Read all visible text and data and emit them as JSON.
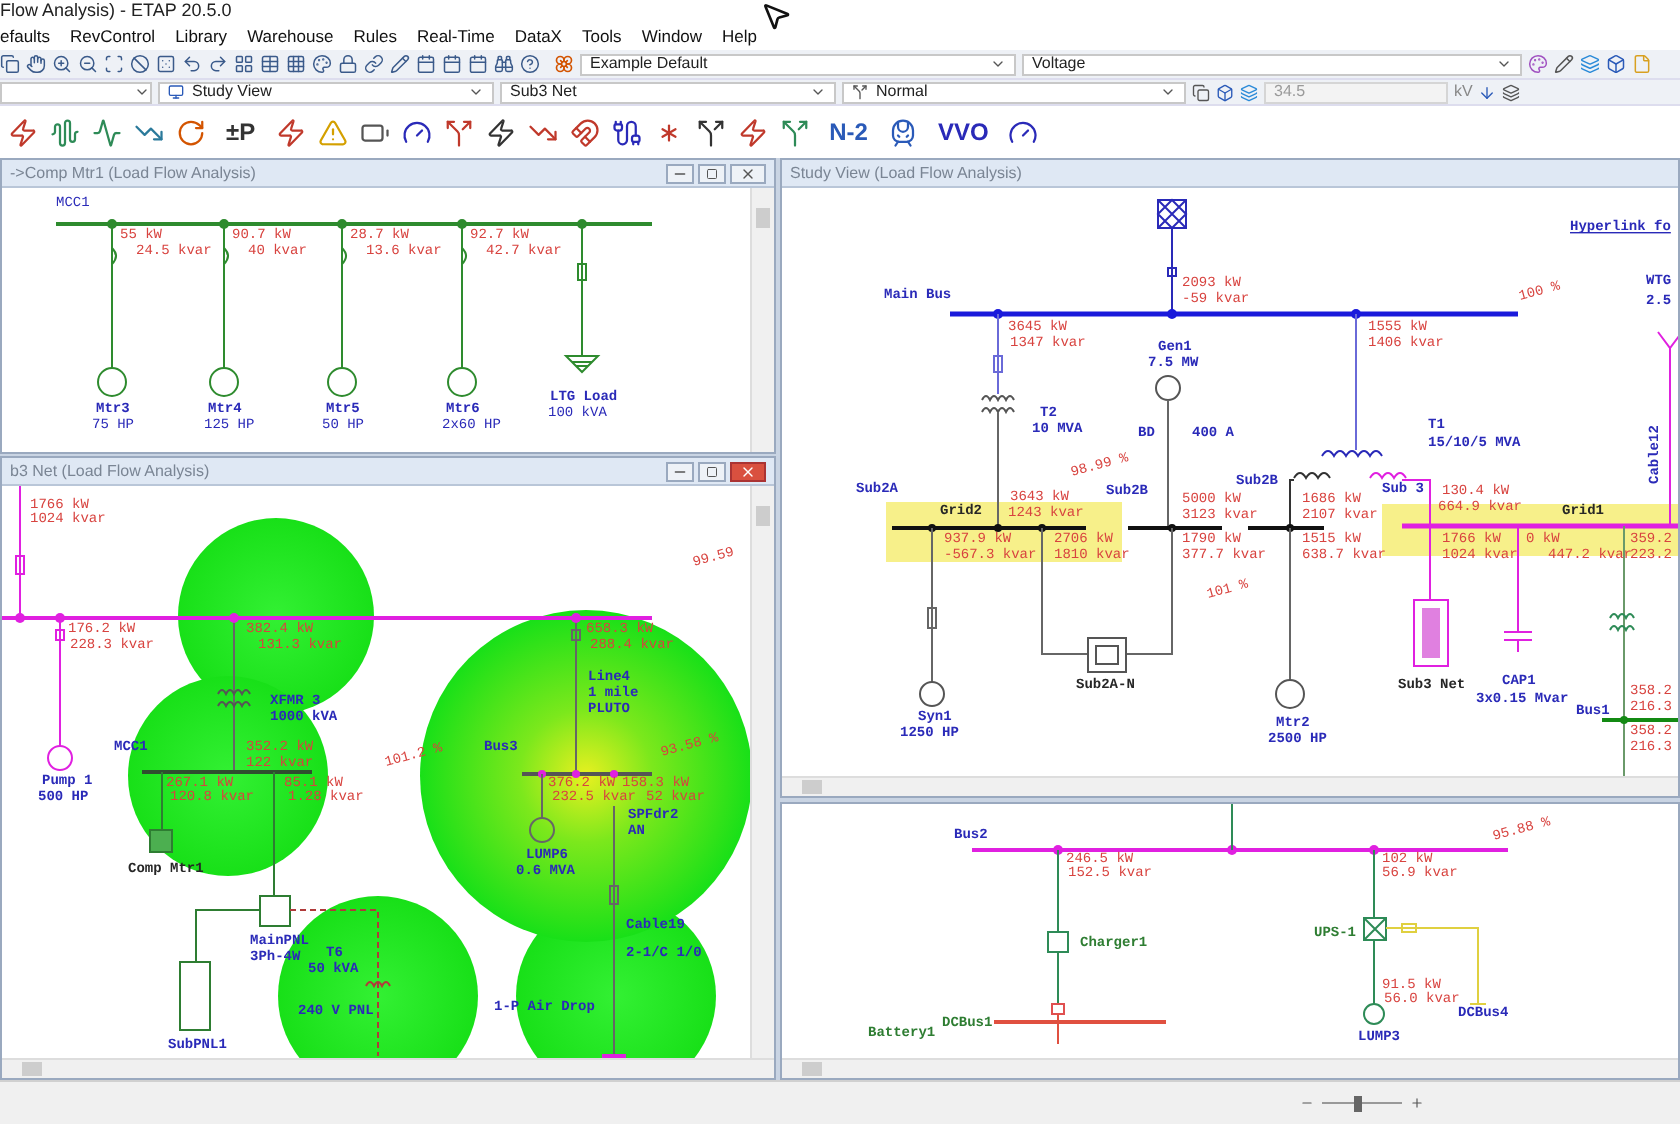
{
  "title_bar": {
    "title": "Flow Analysis) - ETAP 20.5.0"
  },
  "menu": [
    "efaults",
    "RevControl",
    "Library",
    "Warehouse",
    "Rules",
    "Real-Time",
    "DataX",
    "Tools",
    "Window",
    "Help"
  ],
  "toolbar": {
    "presentation": "Example Default",
    "display": "Voltage"
  },
  "toolbar2": {
    "view": "Study View",
    "network": "Sub3 Net",
    "config": "Normal",
    "voltage": {
      "value": "34.5",
      "disabled": true
    },
    "unit": "kV"
  },
  "analysis_toolbar": {
    "labels": [
      "±P",
      "N-2",
      "VVO"
    ]
  },
  "mcc_window": {
    "title": "->Comp Mtr1 (Load Flow Analysis)",
    "bus": "MCC1",
    "loads": [
      {
        "name": "Mtr3",
        "rating": "75 HP",
        "kw": "55 kW",
        "kvar": "24.5 kvar"
      },
      {
        "name": "Mtr4",
        "rating": "125 HP",
        "kw": "90.7 kW",
        "kvar": "40 kvar"
      },
      {
        "name": "Mtr5",
        "rating": "50 HP",
        "kw": "28.7 kW",
        "kvar": "13.6 kvar"
      },
      {
        "name": "Mtr6",
        "rating": "2x60 HP",
        "kw": "92.7 kW",
        "kvar": "42.7 kvar"
      }
    ],
    "lighting_load": {
      "name": "LTG Load",
      "rating": "100 kVA"
    }
  },
  "sub3_window": {
    "title": "b3 Net (Load Flow Analysis)",
    "labels": [
      {
        "text": "1766 kW",
        "kind": "flow"
      },
      {
        "text": "1024 kvar",
        "kind": "flow"
      },
      {
        "text": "99.59",
        "kind": "percent"
      },
      {
        "text": "176.2 kW",
        "kind": "flow"
      },
      {
        "text": "228.3 kvar",
        "kind": "flow"
      },
      {
        "text": "382.4 kW",
        "kind": "flow"
      },
      {
        "text": "131.3 kvar",
        "kind": "flow"
      },
      {
        "text": "XFMR 3",
        "kind": "name"
      },
      {
        "text": "1000 kVA",
        "kind": "name"
      },
      {
        "text": "Pump 1",
        "kind": "name"
      },
      {
        "text": "500 HP",
        "kind": "name"
      },
      {
        "text": "MCC1",
        "kind": "name"
      },
      {
        "text": "352.2 kW",
        "kind": "flow"
      },
      {
        "text": "122 kvar",
        "kind": "flow"
      },
      {
        "text": "267.1 kW",
        "kind": "flow"
      },
      {
        "text": "120.8 kvar",
        "kind": "flow"
      },
      {
        "text": "85.1 kW",
        "kind": "flow"
      },
      {
        "text": "1.28 kvar",
        "kind": "flow"
      },
      {
        "text": "Comp Mtr1",
        "kind": "label"
      },
      {
        "text": "MainPNL",
        "kind": "name"
      },
      {
        "text": "3Ph-4W",
        "kind": "name"
      },
      {
        "text": "T6",
        "kind": "name"
      },
      {
        "text": "50 kVA",
        "kind": "name"
      },
      {
        "text": "240 V PNL",
        "kind": "name"
      },
      {
        "text": "SubPNL1",
        "kind": "name"
      },
      {
        "text": "101.2 %",
        "kind": "percent"
      },
      {
        "text": "Bus3",
        "kind": "name"
      },
      {
        "text": "658.3 kW",
        "kind": "flow"
      },
      {
        "text": "288.4 kvar",
        "kind": "flow"
      },
      {
        "text": "Line4",
        "kind": "name"
      },
      {
        "text": "1 mile",
        "kind": "name"
      },
      {
        "text": "PLUTO",
        "kind": "name"
      },
      {
        "text": "93.58 %",
        "kind": "percent"
      },
      {
        "text": "376.2 kW",
        "kind": "flow"
      },
      {
        "text": "232.5 kvar",
        "kind": "flow"
      },
      {
        "text": "158.3 kW",
        "kind": "flow"
      },
      {
        "text": "52 kvar",
        "kind": "flow"
      },
      {
        "text": "SPFdr2",
        "kind": "name"
      },
      {
        "text": "AN",
        "kind": "name"
      },
      {
        "text": "LUMP6",
        "kind": "name"
      },
      {
        "text": "0.6 MVA",
        "kind": "name"
      },
      {
        "text": "Cable19",
        "kind": "name"
      },
      {
        "text": "2-1/C 1/0",
        "kind": "name"
      },
      {
        "text": "1-P Air Drop",
        "kind": "name"
      }
    ]
  },
  "study_window": {
    "title": "Study View (Load Flow Analysis)",
    "labels": [
      {
        "text": "Hyperlink fo",
        "kind": "link"
      },
      {
        "text": "Main Bus",
        "kind": "name"
      },
      {
        "text": "2093 kW",
        "kind": "flow"
      },
      {
        "text": "-59 kvar",
        "kind": "flow"
      },
      {
        "text": "100 %",
        "kind": "percent"
      },
      {
        "text": "3645 kW",
        "kind": "flow"
      },
      {
        "text": "1347 kvar",
        "kind": "flow"
      },
      {
        "text": "Gen1",
        "kind": "name"
      },
      {
        "text": "7.5 MW",
        "kind": "name"
      },
      {
        "text": "1555 kW",
        "kind": "flow"
      },
      {
        "text": "1406 kvar",
        "kind": "flow"
      },
      {
        "text": "T2",
        "kind": "name"
      },
      {
        "text": "10 MVA",
        "kind": "name"
      },
      {
        "text": "BD",
        "kind": "name"
      },
      {
        "text": "400 A",
        "kind": "name"
      },
      {
        "text": "T1",
        "kind": "name"
      },
      {
        "text": "15/10/5 MVA",
        "kind": "name"
      },
      {
        "text": "WTG",
        "kind": "name"
      },
      {
        "text": "2.5",
        "kind": "name"
      },
      {
        "text": "Cable12",
        "kind": "vertical"
      },
      {
        "text": "98.99 %",
        "kind": "percent"
      },
      {
        "text": "Sub2A",
        "kind": "name"
      },
      {
        "text": "Sub2B",
        "kind": "name"
      },
      {
        "text": "Sub2B",
        "kind": "name"
      },
      {
        "text": "Grid2",
        "kind": "label"
      },
      {
        "text": "3643 kW",
        "kind": "flow"
      },
      {
        "text": "1243 kvar",
        "kind": "flow"
      },
      {
        "text": "937.9 kW",
        "kind": "flow"
      },
      {
        "text": "-567.3 kvar",
        "kind": "flow"
      },
      {
        "text": "2706 kW",
        "kind": "flow"
      },
      {
        "text": "1810 kvar",
        "kind": "flow"
      },
      {
        "text": "5000 kW",
        "kind": "flow"
      },
      {
        "text": "3123 kvar",
        "kind": "flow"
      },
      {
        "text": "1790 kW",
        "kind": "flow"
      },
      {
        "text": "377.7 kvar",
        "kind": "flow"
      },
      {
        "text": "1686 kW",
        "kind": "flow"
      },
      {
        "text": "2107 kvar",
        "kind": "flow"
      },
      {
        "text": "1515 kW",
        "kind": "flow"
      },
      {
        "text": "638.7 kvar",
        "kind": "flow"
      },
      {
        "text": "101 %",
        "kind": "percent"
      },
      {
        "text": "Sub 3",
        "kind": "name"
      },
      {
        "text": "130.4 kW",
        "kind": "flow"
      },
      {
        "text": "664.9 kvar",
        "kind": "flow"
      },
      {
        "text": "Grid1",
        "kind": "label"
      },
      {
        "text": "1766 kW",
        "kind": "flow"
      },
      {
        "text": "1024 kvar",
        "kind": "flow"
      },
      {
        "text": "0 kW",
        "kind": "flow"
      },
      {
        "text": "447.2 kvar",
        "kind": "flow"
      },
      {
        "text": "359.2",
        "kind": "flow"
      },
      {
        "text": "223.2",
        "kind": "flow"
      },
      {
        "text": "Sub2A-N",
        "kind": "label"
      },
      {
        "text": "Syn1",
        "kind": "name"
      },
      {
        "text": "1250 HP",
        "kind": "name"
      },
      {
        "text": "Mtr2",
        "kind": "name"
      },
      {
        "text": "2500 HP",
        "kind": "name"
      },
      {
        "text": "Sub3 Net",
        "kind": "label"
      },
      {
        "text": "CAP1",
        "kind": "name"
      },
      {
        "text": "3x0.15 Mvar",
        "kind": "name"
      },
      {
        "text": "Bus1",
        "kind": "name"
      },
      {
        "text": "358.2",
        "kind": "flow"
      },
      {
        "text": "216.3",
        "kind": "flow"
      },
      {
        "text": "358.2",
        "kind": "flow"
      },
      {
        "text": "216.3",
        "kind": "flow"
      }
    ]
  },
  "dc_window": {
    "labels": [
      {
        "text": "Bus2",
        "kind": "name"
      },
      {
        "text": "95.88 %",
        "kind": "percent"
      },
      {
        "text": "246.5 kW",
        "kind": "flow"
      },
      {
        "text": "152.5 kvar",
        "kind": "flow"
      },
      {
        "text": "102 kW",
        "kind": "flow"
      },
      {
        "text": "56.9 kvar",
        "kind": "flow"
      },
      {
        "text": "Charger1",
        "kind": "dc"
      },
      {
        "text": "UPS-1",
        "kind": "dc"
      },
      {
        "text": "91.5 kW",
        "kind": "flow"
      },
      {
        "text": "56.0 kvar",
        "kind": "flow"
      },
      {
        "text": "DCBus4",
        "kind": "name"
      },
      {
        "text": "LUMP3",
        "kind": "name"
      },
      {
        "text": "DCBus1",
        "kind": "dc"
      },
      {
        "text": "Battery1",
        "kind": "dc"
      }
    ]
  },
  "status_bar": {
    "zoom": {
      "level": 0.45
    }
  }
}
